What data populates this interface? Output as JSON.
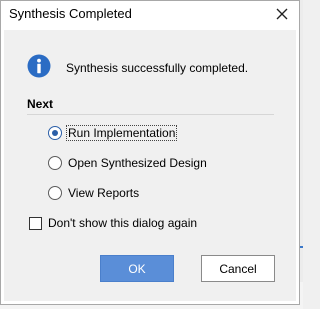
{
  "dialog": {
    "title": "Synthesis Completed",
    "message": "Synthesis successfully completed.",
    "next_heading": "Next",
    "options": [
      {
        "label": "Run Implementation",
        "selected": true
      },
      {
        "label": "Open Synthesized Design",
        "selected": false
      },
      {
        "label": "View Reports",
        "selected": false
      }
    ],
    "dont_show_label": "Don't show this dialog again",
    "dont_show_checked": false,
    "ok_label": "OK",
    "cancel_label": "Cancel"
  },
  "icons": {
    "close": "close-icon",
    "info": "info-icon"
  },
  "colors": {
    "accent": "#2b5fa8",
    "ok_button": "#5a8ed8",
    "info_icon": "#2b6cc4"
  }
}
